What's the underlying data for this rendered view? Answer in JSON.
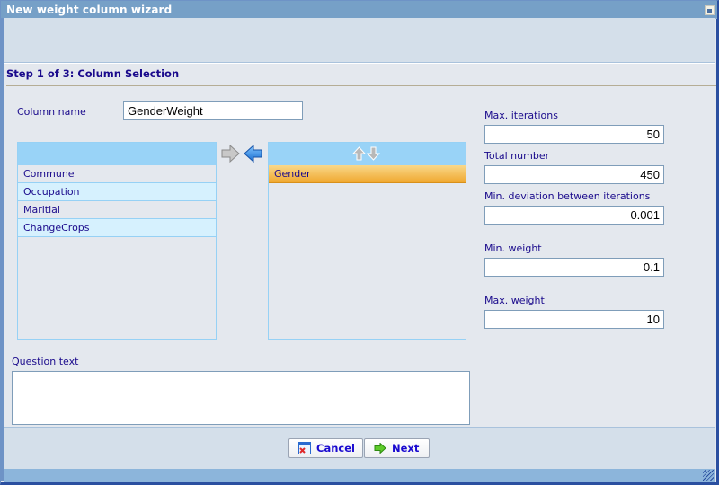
{
  "window": {
    "title": "New weight column wizard"
  },
  "step": {
    "title": "Step 1 of 3: Column Selection"
  },
  "column_name": {
    "label": "Column name",
    "value": "GenderWeight"
  },
  "available_columns": {
    "items": [
      "Commune",
      "Occupation",
      "Maritial",
      "ChangeCrops"
    ]
  },
  "selected_columns": {
    "items": [
      "Gender"
    ],
    "selected_index": 0
  },
  "settings": {
    "max_iterations": {
      "label": "Max. iterations",
      "value": "50"
    },
    "total_number": {
      "label": "Total number",
      "value": "450"
    },
    "min_deviation": {
      "label": "Min. deviation between iterations",
      "value": "0.001"
    },
    "min_weight": {
      "label": "Min. weight",
      "value": "0.1"
    },
    "max_weight": {
      "label": "Max. weight",
      "value": "10"
    }
  },
  "question_text": {
    "label": "Question text",
    "value": ""
  },
  "buttons": {
    "cancel": "Cancel",
    "next": "Next"
  }
}
